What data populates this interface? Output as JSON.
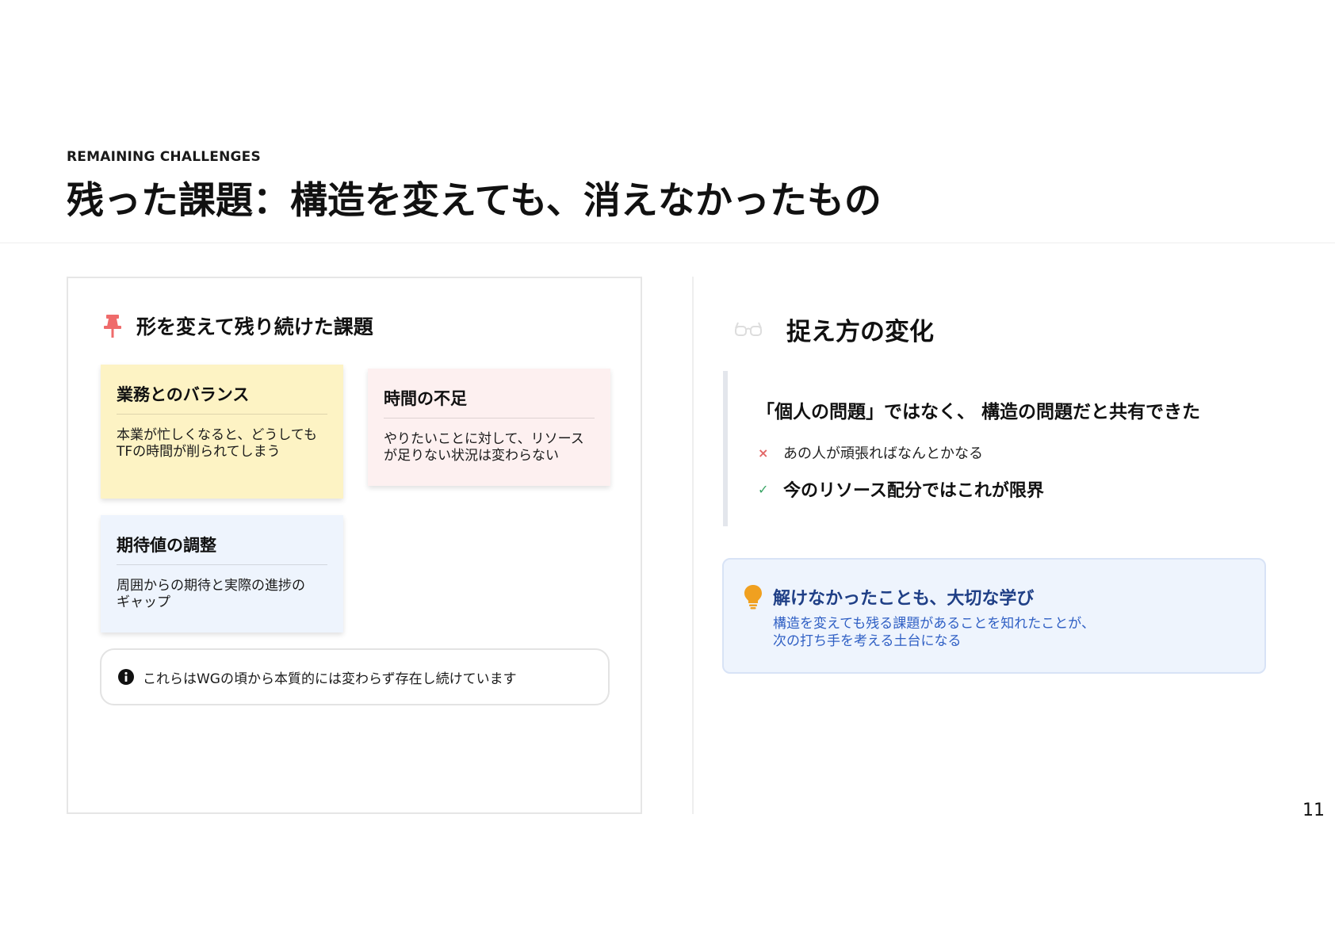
{
  "header": {
    "eyebrow": "REMAINING CHALLENGES",
    "title": "残った課題：構造を変えても、消えなかったもの"
  },
  "left_panel": {
    "heading": "形を変えて残り続けた課題",
    "heading_icon": "pin-icon",
    "notes": [
      {
        "title": "業務とのバランス",
        "body_lines": [
          "本業が忙しくなると、どうしても",
          "TFの時間が削られてしまう"
        ],
        "color": "#fdf3c4"
      },
      {
        "title": "時間の不足",
        "body_lines": [
          "やりたいことに対して、リソース",
          "が足りない状況は変わらない"
        ],
        "color": "#fdf0f0"
      },
      {
        "title": "期待値の調整",
        "body_lines": [
          "周囲からの期待と実際の進捗の",
          "ギャップ"
        ],
        "color": "#eef4fd"
      }
    ],
    "info": {
      "icon": "info-icon",
      "text": "これらはWGの頃から本質的には変わらず存在し続けています"
    }
  },
  "right_panel": {
    "heading": "捉え方の変化",
    "heading_icon": "glasses-icon",
    "quote": "「個人の問題」ではなく、 構造の問題だと共有できた",
    "rows": [
      {
        "mark": "×",
        "text": "あの人が頑張ればなんとかなる"
      },
      {
        "mark": "✓",
        "text": "今のリソース配分ではこれが限界"
      }
    ],
    "insight": {
      "icon": "lightbulb-icon",
      "title": "解けなかったことも、大切な学び",
      "body_lines": [
        "構造を変えても残る課題があることを知れたことが、",
        "次の打ち手を考える土台になる"
      ]
    }
  },
  "colors": {
    "pin": "#ef6b6b",
    "insight_title": "#1f3f86",
    "insight_body": "#2f5fc4",
    "bulb": "#f0a020",
    "cross": "#e26666",
    "check": "#3aa565"
  },
  "page_number": "11"
}
